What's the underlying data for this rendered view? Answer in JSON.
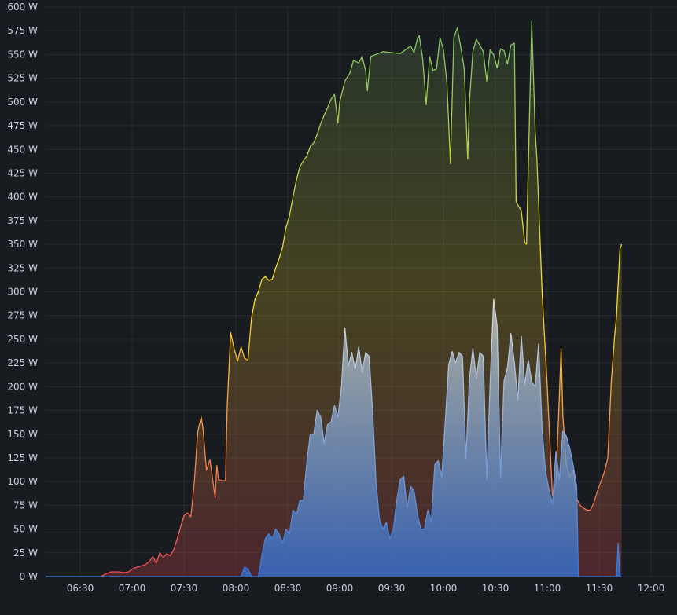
{
  "chart_data": {
    "type": "area",
    "title": "",
    "xlabel": "",
    "ylabel": "",
    "y_unit": "W",
    "xlim": [
      "06:10",
      "12:15"
    ],
    "ylim": [
      0,
      600
    ],
    "grid": true,
    "legend": "none",
    "x_ticks": [
      "06:30",
      "07:00",
      "07:30",
      "08:00",
      "08:30",
      "09:00",
      "09:30",
      "10:00",
      "10:30",
      "11:00",
      "11:30",
      "12:00"
    ],
    "y_ticks": [
      "0 W",
      "25 W",
      "50 W",
      "75 W",
      "100 W",
      "125 W",
      "150 W",
      "175 W",
      "200 W",
      "225 W",
      "250 W",
      "275 W",
      "300 W",
      "325 W",
      "350 W",
      "375 W",
      "400 W",
      "425 W",
      "450 W",
      "475 W",
      "500 W",
      "525 W",
      "550 W",
      "575 W",
      "600 W"
    ],
    "series": [
      {
        "style": "gradient-red-yellow-green",
        "colors": {
          "low": "#f2495c",
          "mid": "#fade2a",
          "high": "#73bf69"
        },
        "points": [
          [
            "06:10",
            0
          ],
          [
            "06:42",
            0
          ],
          [
            "06:45",
            3
          ],
          [
            "06:48",
            5
          ],
          [
            "06:52",
            5
          ],
          [
            "06:55",
            4
          ],
          [
            "06:58",
            5
          ],
          [
            "07:01",
            9
          ],
          [
            "07:05",
            11
          ],
          [
            "07:08",
            13
          ],
          [
            "07:10",
            16
          ],
          [
            "07:12",
            21
          ],
          [
            "07:14",
            14
          ],
          [
            "07:16",
            25
          ],
          [
            "07:18",
            20
          ],
          [
            "07:20",
            24
          ],
          [
            "07:22",
            22
          ],
          [
            "07:24",
            28
          ],
          [
            "07:26",
            39
          ],
          [
            "07:28",
            52
          ],
          [
            "07:30",
            64
          ],
          [
            "07:32",
            67
          ],
          [
            "07:34",
            63
          ],
          [
            "07:36",
            100
          ],
          [
            "07:38",
            153
          ],
          [
            "07:40",
            168
          ],
          [
            "07:41",
            156
          ],
          [
            "07:43",
            112
          ],
          [
            "07:45",
            123
          ],
          [
            "07:46",
            110
          ],
          [
            "07:48",
            83
          ],
          [
            "07:49",
            117
          ],
          [
            "07:50",
            102
          ],
          [
            "07:52",
            101
          ],
          [
            "07:54",
            101
          ],
          [
            "07:55",
            180
          ],
          [
            "07:57",
            257
          ],
          [
            "07:59",
            240
          ],
          [
            "08:01",
            227
          ],
          [
            "08:03",
            242
          ],
          [
            "08:05",
            230
          ],
          [
            "08:07",
            228
          ],
          [
            "08:09",
            272
          ],
          [
            "08:11",
            292
          ],
          [
            "08:13",
            300
          ],
          [
            "08:15",
            313
          ],
          [
            "08:17",
            316
          ],
          [
            "08:19",
            312
          ],
          [
            "08:21",
            313
          ],
          [
            "08:23",
            325
          ],
          [
            "08:25",
            335
          ],
          [
            "08:27",
            347
          ],
          [
            "08:29",
            368
          ],
          [
            "08:31",
            380
          ],
          [
            "08:33",
            400
          ],
          [
            "08:35",
            418
          ],
          [
            "08:37",
            432
          ],
          [
            "08:39",
            438
          ],
          [
            "08:41",
            443
          ],
          [
            "08:43",
            453
          ],
          [
            "08:45",
            457
          ],
          [
            "08:47",
            466
          ],
          [
            "08:49",
            477
          ],
          [
            "08:51",
            486
          ],
          [
            "08:53",
            494
          ],
          [
            "08:55",
            503
          ],
          [
            "08:57",
            508
          ],
          [
            "08:59",
            478
          ],
          [
            "09:00",
            500
          ],
          [
            "09:03",
            522
          ],
          [
            "09:06",
            531
          ],
          [
            "09:08",
            544
          ],
          [
            "09:11",
            541
          ],
          [
            "09:13",
            548
          ],
          [
            "09:15",
            533
          ],
          [
            "09:16",
            512
          ],
          [
            "09:18",
            548
          ],
          [
            "09:21",
            550
          ],
          [
            "09:25",
            553
          ],
          [
            "09:30",
            552
          ],
          [
            "09:35",
            551
          ],
          [
            "09:38",
            555
          ],
          [
            "09:41",
            559
          ],
          [
            "09:43",
            552
          ],
          [
            "09:45",
            567
          ],
          [
            "09:46",
            570
          ],
          [
            "09:48",
            545
          ],
          [
            "09:50",
            497
          ],
          [
            "09:52",
            548
          ],
          [
            "09:54",
            533
          ],
          [
            "09:56",
            535
          ],
          [
            "09:58",
            568
          ],
          [
            "10:00",
            555
          ],
          [
            "10:02",
            520
          ],
          [
            "10:04",
            435
          ],
          [
            "10:06",
            568
          ],
          [
            "10:08",
            578
          ],
          [
            "10:10",
            558
          ],
          [
            "10:12",
            535
          ],
          [
            "10:14",
            440
          ],
          [
            "10:15",
            500
          ],
          [
            "10:17",
            553
          ],
          [
            "10:19",
            566
          ],
          [
            "10:21",
            560
          ],
          [
            "10:23",
            553
          ],
          [
            "10:25",
            522
          ],
          [
            "10:27",
            555
          ],
          [
            "10:29",
            550
          ],
          [
            "10:31",
            536
          ],
          [
            "10:33",
            556
          ],
          [
            "10:35",
            554
          ],
          [
            "10:37",
            540
          ],
          [
            "10:39",
            560
          ],
          [
            "10:41",
            562
          ],
          [
            "10:42",
            395
          ],
          [
            "10:45",
            385
          ],
          [
            "10:47",
            352
          ],
          [
            "10:48",
            350
          ],
          [
            "10:51",
            585
          ],
          [
            "10:53",
            470
          ],
          [
            "10:54",
            440
          ],
          [
            "10:57",
            300
          ],
          [
            "11:00",
            200
          ],
          [
            "11:03",
            85
          ],
          [
            "11:05",
            100
          ],
          [
            "11:07",
            190
          ],
          [
            "11:08",
            240
          ],
          [
            "11:09",
            170
          ],
          [
            "11:11",
            118
          ],
          [
            "11:13",
            105
          ],
          [
            "11:15",
            112
          ],
          [
            "11:17",
            82
          ],
          [
            "11:19",
            75
          ],
          [
            "11:21",
            72
          ],
          [
            "11:23",
            70
          ],
          [
            "11:25",
            70
          ],
          [
            "11:27",
            78
          ],
          [
            "11:29",
            90
          ],
          [
            "11:31",
            100
          ],
          [
            "11:33",
            110
          ],
          [
            "11:35",
            125
          ],
          [
            "11:37",
            205
          ],
          [
            "11:39",
            255
          ],
          [
            "11:40",
            273
          ],
          [
            "11:42",
            345
          ],
          [
            "11:43",
            350
          ]
        ]
      },
      {
        "style": "gradient-blue-white",
        "colors": {
          "low": "#3274d9",
          "high": "#d8d9da"
        },
        "points": [
          [
            "06:10",
            0
          ],
          [
            "08:03",
            0
          ],
          [
            "08:05",
            10
          ],
          [
            "08:07",
            8
          ],
          [
            "08:09",
            0
          ],
          [
            "08:13",
            0
          ],
          [
            "08:15",
            22
          ],
          [
            "08:17",
            40
          ],
          [
            "08:19",
            45
          ],
          [
            "08:21",
            40
          ],
          [
            "08:23",
            50
          ],
          [
            "08:25",
            45
          ],
          [
            "08:27",
            35
          ],
          [
            "08:29",
            50
          ],
          [
            "08:31",
            45
          ],
          [
            "08:33",
            70
          ],
          [
            "08:35",
            65
          ],
          [
            "08:37",
            80
          ],
          [
            "08:39",
            80
          ],
          [
            "08:41",
            120
          ],
          [
            "08:43",
            150
          ],
          [
            "08:45",
            150
          ],
          [
            "08:47",
            175
          ],
          [
            "08:49",
            168
          ],
          [
            "08:51",
            140
          ],
          [
            "08:53",
            160
          ],
          [
            "08:55",
            163
          ],
          [
            "08:57",
            180
          ],
          [
            "08:59",
            168
          ],
          [
            "09:01",
            200
          ],
          [
            "09:03",
            262
          ],
          [
            "09:05",
            222
          ],
          [
            "09:07",
            236
          ],
          [
            "09:09",
            218
          ],
          [
            "09:11",
            242
          ],
          [
            "09:13",
            215
          ],
          [
            "09:15",
            236
          ],
          [
            "09:17",
            232
          ],
          [
            "09:19",
            175
          ],
          [
            "09:21",
            100
          ],
          [
            "09:23",
            60
          ],
          [
            "09:25",
            50
          ],
          [
            "09:27",
            57
          ],
          [
            "09:29",
            40
          ],
          [
            "09:31",
            50
          ],
          [
            "09:33",
            80
          ],
          [
            "09:35",
            102
          ],
          [
            "09:37",
            106
          ],
          [
            "09:39",
            72
          ],
          [
            "09:41",
            95
          ],
          [
            "09:43",
            90
          ],
          [
            "09:45",
            65
          ],
          [
            "09:47",
            50
          ],
          [
            "09:49",
            50
          ],
          [
            "09:51",
            70
          ],
          [
            "09:53",
            58
          ],
          [
            "09:55",
            118
          ],
          [
            "09:57",
            122
          ],
          [
            "09:59",
            105
          ],
          [
            "10:01",
            162
          ],
          [
            "10:03",
            223
          ],
          [
            "10:05",
            237
          ],
          [
            "10:07",
            225
          ],
          [
            "10:09",
            236
          ],
          [
            "10:11",
            232
          ],
          [
            "10:13",
            124
          ],
          [
            "10:15",
            208
          ],
          [
            "10:17",
            240
          ],
          [
            "10:19",
            209
          ],
          [
            "10:21",
            236
          ],
          [
            "10:23",
            232
          ],
          [
            "10:25",
            103
          ],
          [
            "10:27",
            205
          ],
          [
            "10:29",
            292
          ],
          [
            "10:31",
            264
          ],
          [
            "10:33",
            104
          ],
          [
            "10:35",
            206
          ],
          [
            "10:37",
            220
          ],
          [
            "10:39",
            256
          ],
          [
            "10:41",
            225
          ],
          [
            "10:43",
            186
          ],
          [
            "10:45",
            253
          ],
          [
            "10:47",
            202
          ],
          [
            "10:49",
            228
          ],
          [
            "10:51",
            205
          ],
          [
            "10:53",
            200
          ],
          [
            "10:55",
            245
          ],
          [
            "10:57",
            155
          ],
          [
            "10:59",
            110
          ],
          [
            "11:01",
            92
          ],
          [
            "11:03",
            76
          ],
          [
            "11:05",
            132
          ],
          [
            "11:07",
            102
          ],
          [
            "11:09",
            153
          ],
          [
            "11:11",
            148
          ],
          [
            "11:13",
            135
          ],
          [
            "11:15",
            117
          ],
          [
            "11:17",
            95
          ],
          [
            "11:18",
            0
          ],
          [
            "11:40",
            0
          ],
          [
            "11:41",
            35
          ],
          [
            "11:42",
            0
          ],
          [
            "11:43",
            0
          ]
        ]
      }
    ]
  }
}
